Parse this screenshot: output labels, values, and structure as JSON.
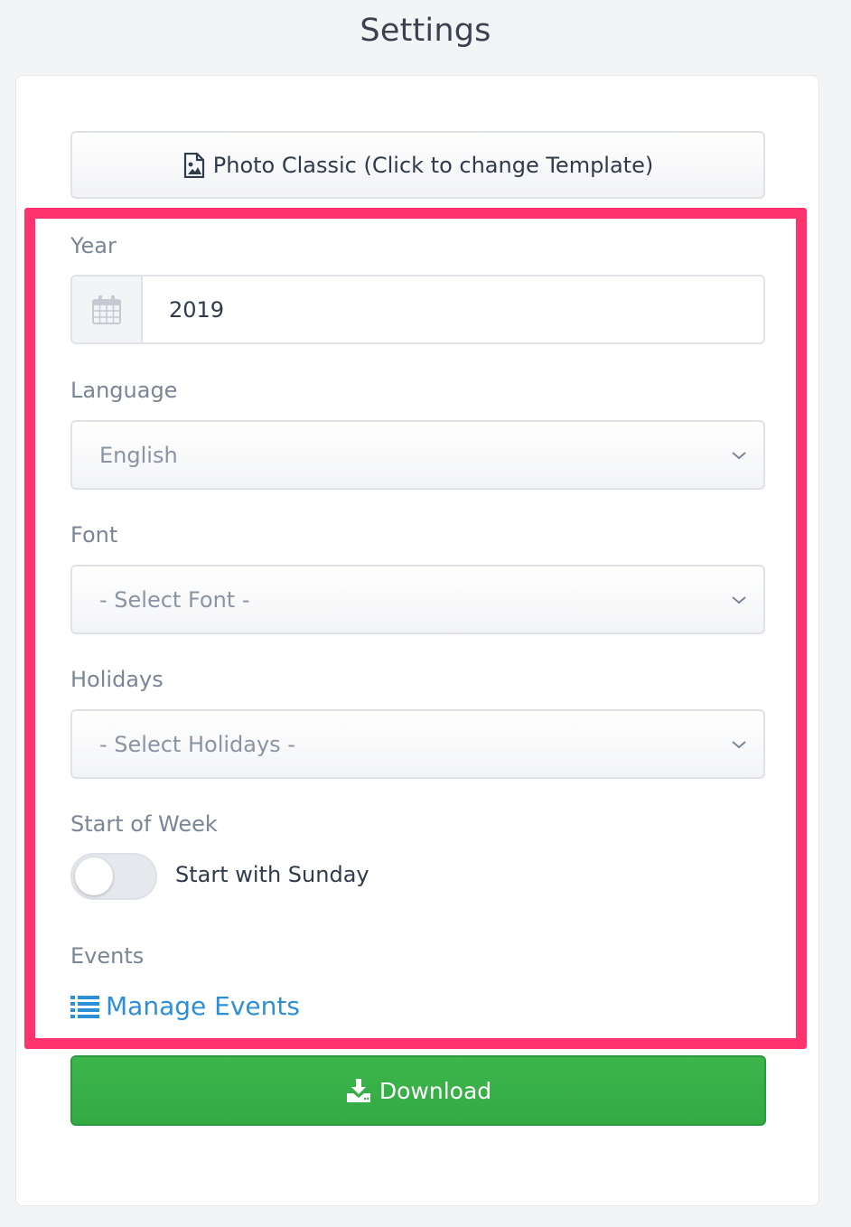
{
  "page": {
    "title": "Settings"
  },
  "template_button": {
    "label": "Photo Classic (Click to change Template)",
    "icon": "image-file-icon"
  },
  "year": {
    "label": "Year",
    "value": "2019",
    "icon": "calendar-icon"
  },
  "language": {
    "label": "Language",
    "selected": "English"
  },
  "font": {
    "label": "Font",
    "selected": "- Select Font -"
  },
  "holidays": {
    "label": "Holidays",
    "selected": "- Select Holidays -"
  },
  "start_of_week": {
    "label": "Start of Week",
    "toggle_label": "Start with Sunday",
    "enabled": false
  },
  "events": {
    "label": "Events",
    "link_label": "Manage Events",
    "icon": "list-icon"
  },
  "download_button": {
    "label": "Download",
    "icon": "download-icon"
  },
  "colors": {
    "highlight": "#ff336e",
    "download": "#37ae47",
    "link": "#2d8fd8"
  }
}
